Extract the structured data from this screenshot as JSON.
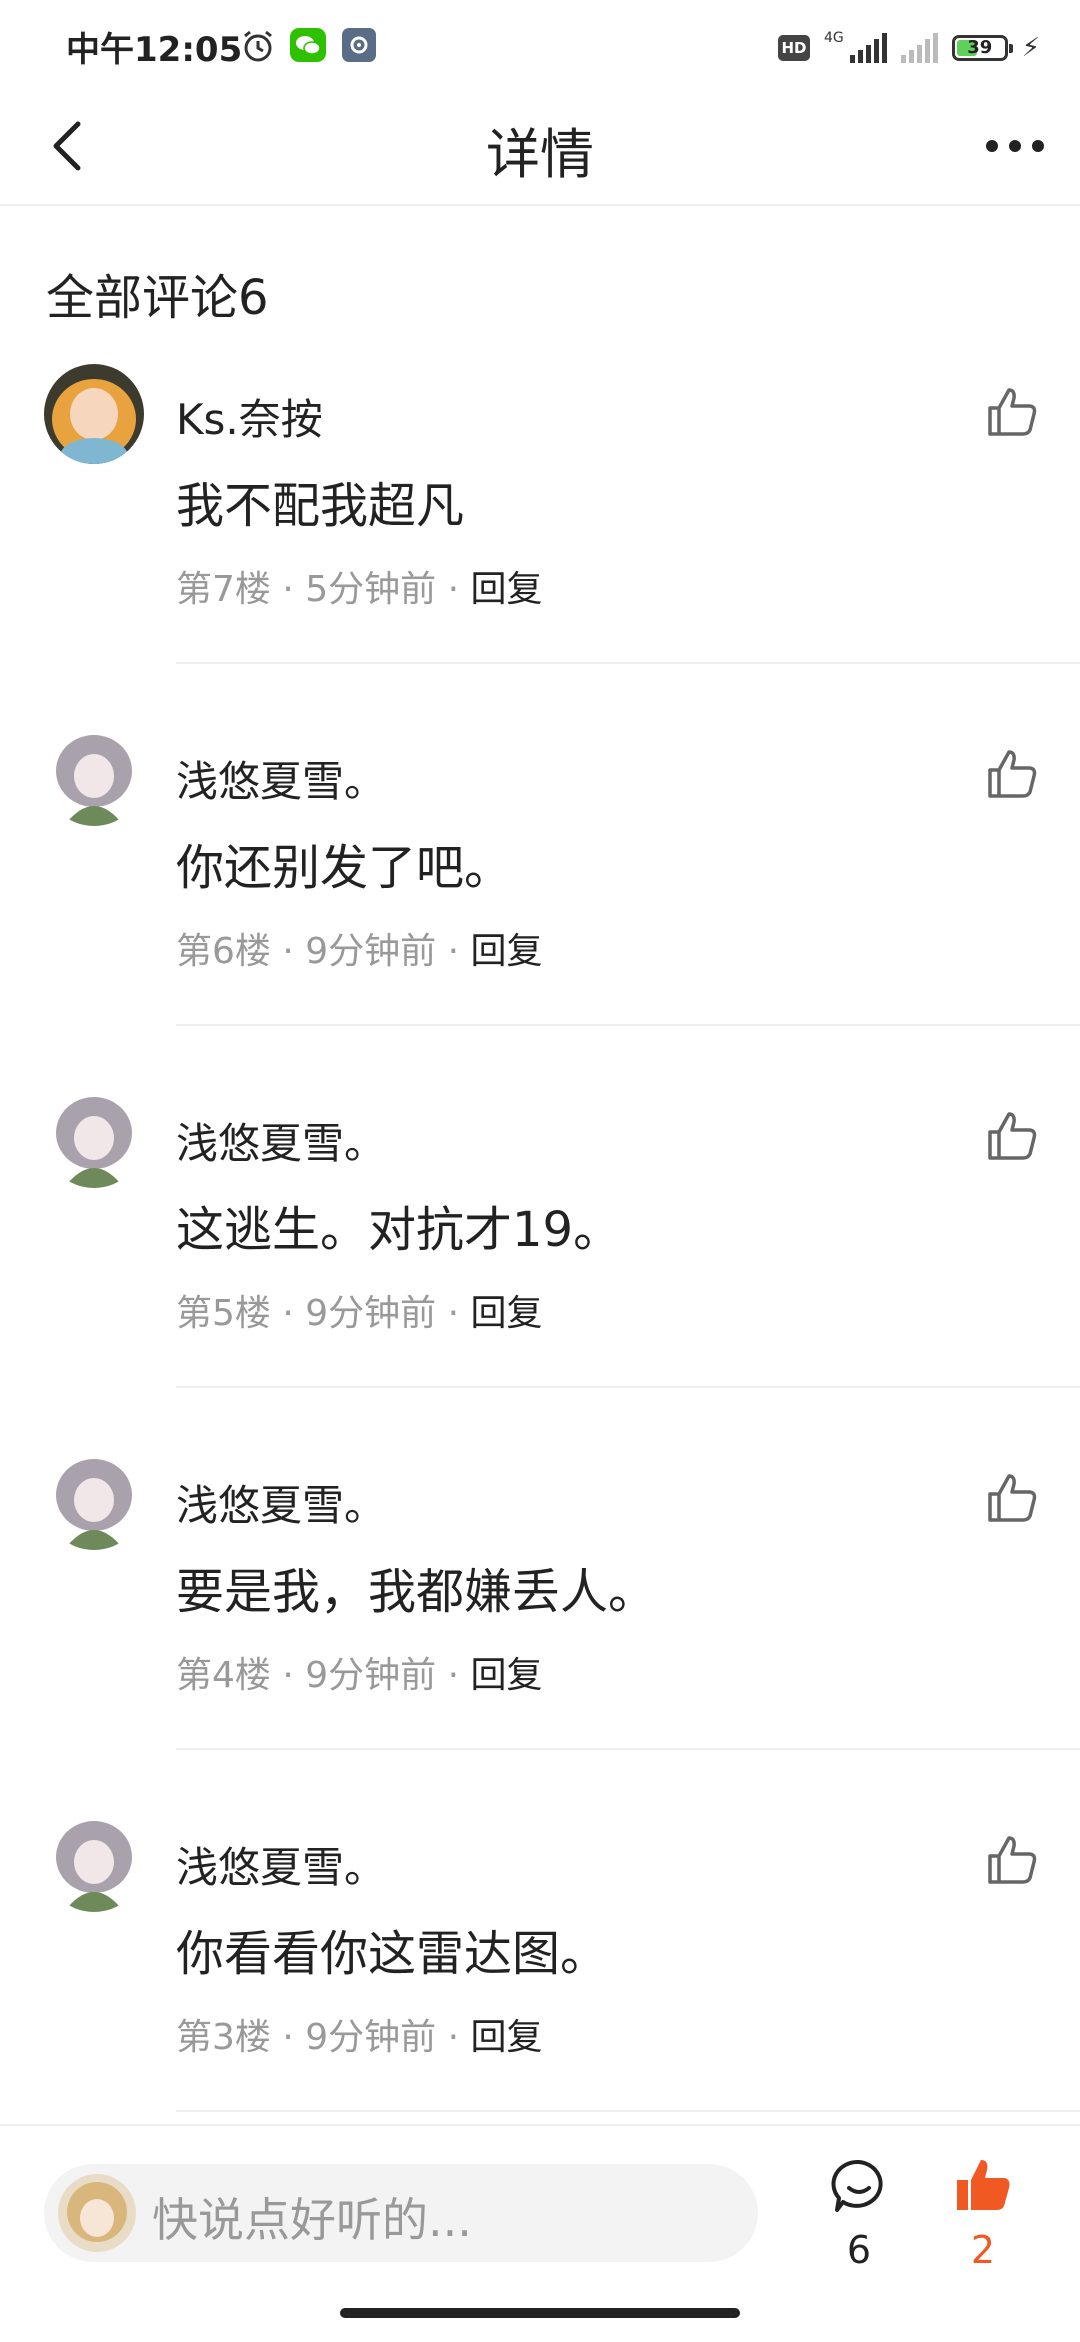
{
  "status_bar": {
    "time": "中午12:05",
    "network": "4G",
    "battery": "39",
    "hd_label": "HD"
  },
  "nav": {
    "title": "详情"
  },
  "section": {
    "title": "全部评论6"
  },
  "comments": [
    {
      "user": "Ks.奈按",
      "text": "我不配我超凡",
      "floor": "第7楼",
      "time": "5分钟前",
      "reply": "回复"
    },
    {
      "user": "浅悠夏雪。",
      "text": "你还别发了吧。",
      "floor": "第6楼",
      "time": "9分钟前",
      "reply": "回复"
    },
    {
      "user": "浅悠夏雪。",
      "text": "这逃生。对抗才19。",
      "floor": "第5楼",
      "time": "9分钟前",
      "reply": "回复"
    },
    {
      "user": "浅悠夏雪。",
      "text": "要是我，我都嫌丢人。",
      "floor": "第4楼",
      "time": "9分钟前",
      "reply": "回复"
    },
    {
      "user": "浅悠夏雪。",
      "text": "你看看你这雷达图。",
      "floor": "第3楼",
      "time": "9分钟前",
      "reply": "回复"
    }
  ],
  "bottom_bar": {
    "placeholder": "快说点好听的...",
    "comment_count": "6",
    "like_count": "2"
  },
  "colors": {
    "accent": "#f05a22",
    "divider": "#eeeeee",
    "meta": "#999999"
  }
}
